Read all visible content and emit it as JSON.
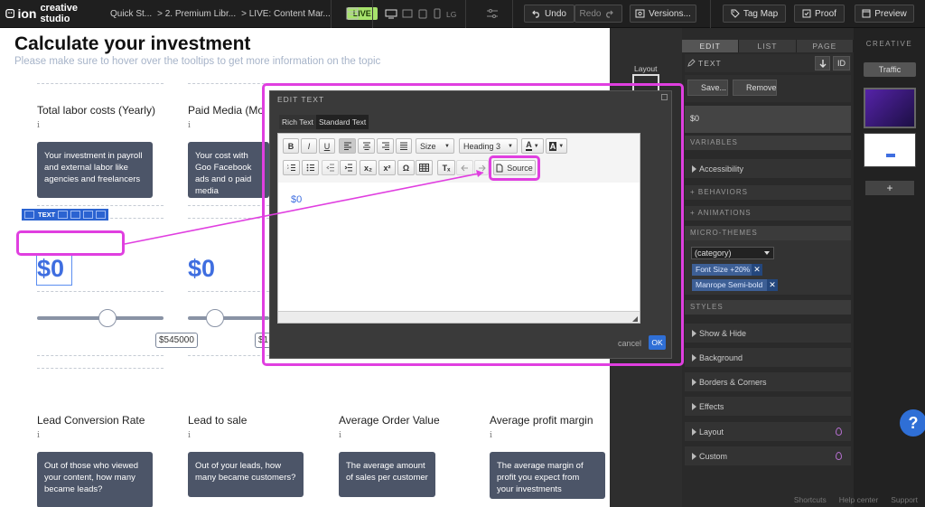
{
  "app": {
    "logo_ion": "ion",
    "logo_studio": "creative studio",
    "crumbs": [
      "Quick St...",
      "> 2. Premium Libr...",
      "> LIVE: Content Mar..."
    ],
    "live_badge": "LIVE"
  },
  "toolbar": {
    "device_label": "LG",
    "undo": "Undo",
    "redo": "Redo",
    "versions": "Versions...",
    "tag_map": "Tag Map",
    "proof": "Proof",
    "preview": "Preview"
  },
  "page": {
    "title": "Calculate your investment",
    "subtitle": "Please make sure to hover over the tooltips to get more information on the topic",
    "row1": [
      {
        "title": "Total labor costs (Yearly)",
        "tip": "Your investment in payroll and external labor like agencies and freelancers",
        "value": "$0"
      },
      {
        "title": "Paid Media (Mo",
        "tip": "Your cost with Goo Facebook ads and o paid media",
        "value": "$0"
      }
    ],
    "slider_value": "$545000",
    "slider_value2": "$1",
    "row2": [
      {
        "title": "Lead Conversion Rate",
        "tip": "Out of those who viewed your content, how many became leads?"
      },
      {
        "title": "Lead to sale",
        "tip": "Out of your leads, how many became customers?"
      },
      {
        "title": "Average Order Value",
        "tip": "The average amount of sales per customer"
      },
      {
        "title": "Average profit margin",
        "tip": "The average margin of profit you expect from your investments"
      }
    ],
    "info_glyph": "i",
    "text_toolbar_label": "TEXT",
    "slider1_level": 0.56,
    "slider2_level": 0.33
  },
  "modal": {
    "title": "EDIT TEXT",
    "tabs": [
      "Rich Text",
      "Standard Text"
    ],
    "size_label": "Size",
    "heading_label": "Heading 3",
    "source_label": "Source",
    "content": "$0",
    "cancel": "cancel",
    "ok": "OK",
    "toolbar_glyphs": {
      "bold": "B",
      "italic": "I",
      "underline": "U",
      "omega": "Ω",
      "sub": "x₂",
      "sup": "x²",
      "clear": "Tₓ"
    }
  },
  "panel": {
    "tabs": [
      "EDIT",
      "LIST",
      "PAGE"
    ],
    "layout_label": "Layout",
    "text_header": "TEXT",
    "id_label": "ID",
    "save": "Save...",
    "remove": "Remove",
    "value": "$0",
    "variables": "VARIABLES",
    "accessibility": "Accessibility",
    "behaviors": "+ BEHAVIORS",
    "animations": "+ ANIMATIONS",
    "micro_themes": "MICRO-THEMES",
    "category": "(category)",
    "chips": [
      "Font Size +20%",
      "Manrope Semi-bold"
    ],
    "styles": "STYLES",
    "style_items": [
      "Show & Hide",
      "Background",
      "Borders & Corners",
      "Effects",
      "Layout",
      "Custom"
    ]
  },
  "creative": {
    "label": "CREATIVE",
    "traffic": "Traffic",
    "plus": "+"
  },
  "footer": {
    "shortcuts": "Shortcuts",
    "help": "Help center",
    "support": "Support"
  },
  "help_fab": "?"
}
